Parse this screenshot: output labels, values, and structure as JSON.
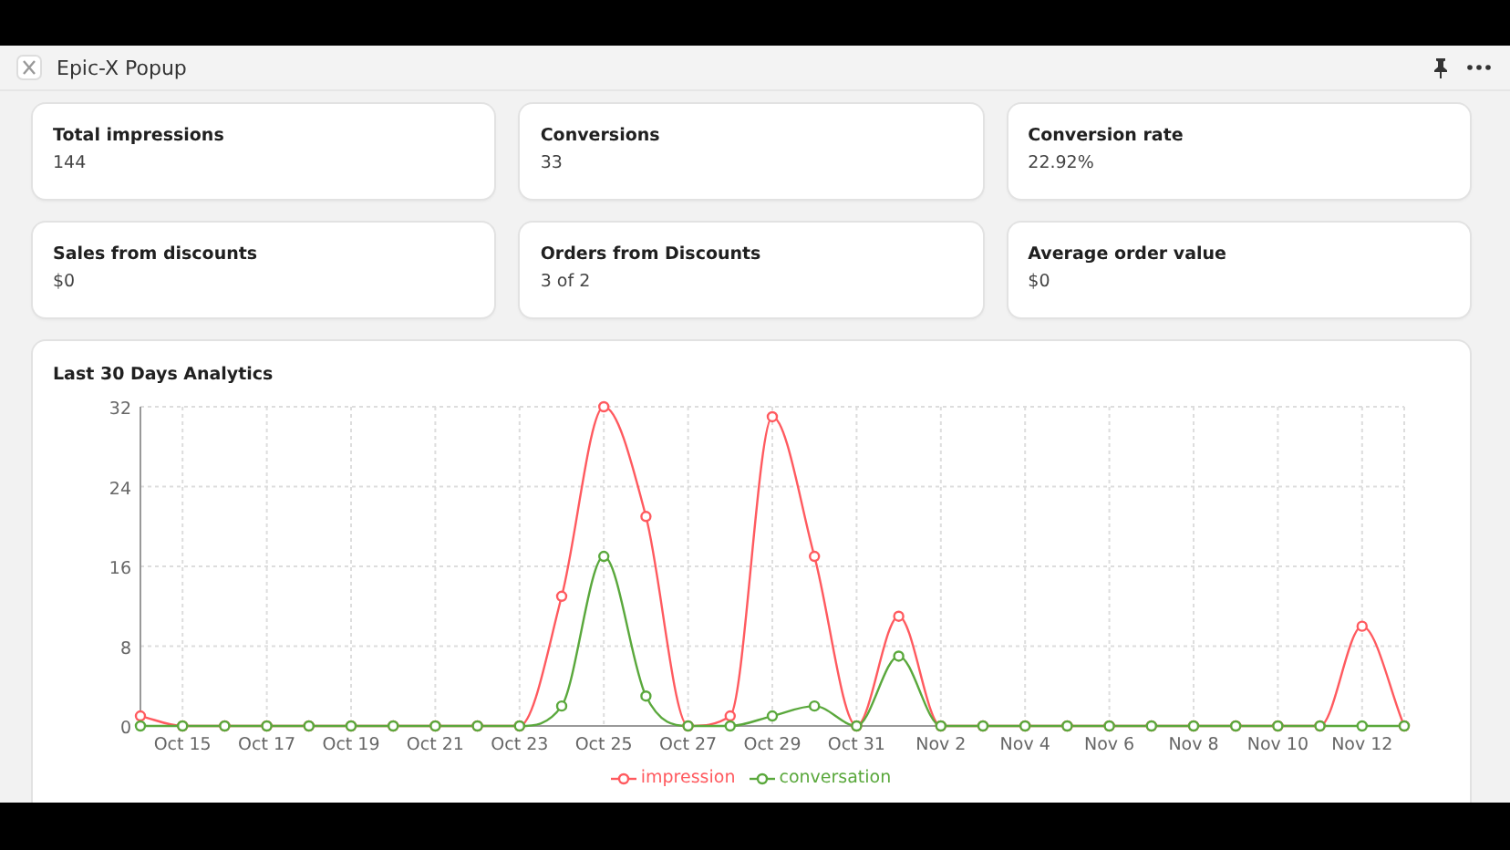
{
  "window": {
    "title": "Epic-X Popup"
  },
  "stats": [
    {
      "label": "Total impressions",
      "value": "144"
    },
    {
      "label": "Conversions",
      "value": "33"
    },
    {
      "label": "Conversion rate",
      "value": "22.92%"
    },
    {
      "label": "Sales from discounts",
      "value": "$0"
    },
    {
      "label": "Orders from Discounts",
      "value": "3 of 2"
    },
    {
      "label": "Average order value",
      "value": "$0"
    }
  ],
  "analytics": {
    "title": "Last 30 Days Analytics",
    "chart_data": {
      "type": "line",
      "categories": [
        null,
        "Oct 15",
        null,
        "Oct 17",
        null,
        "Oct 19",
        null,
        "Oct 21",
        null,
        "Oct 23",
        null,
        "Oct 25",
        null,
        "Oct 27",
        null,
        "Oct 29",
        null,
        "Oct 31",
        null,
        "Nov 2",
        null,
        "Nov 4",
        null,
        "Nov 6",
        null,
        "Nov 8",
        null,
        "Nov 10",
        null,
        "Nov 12",
        null
      ],
      "ylim": [
        0,
        32
      ],
      "yticks": [
        0,
        8,
        16,
        24,
        32
      ],
      "grid": true,
      "series": [
        {
          "name": "impression",
          "color": "#ff5a5f",
          "marker": true,
          "values": [
            1,
            0,
            0,
            0,
            0,
            0,
            0,
            0,
            0,
            0,
            13,
            32,
            21,
            0,
            1,
            31,
            17,
            0,
            11,
            0,
            0,
            0,
            0,
            0,
            0,
            0,
            0,
            0,
            0,
            10,
            0
          ]
        },
        {
          "name": "conversation",
          "color": "#5aa83c",
          "marker": true,
          "values": [
            0,
            0,
            0,
            0,
            0,
            0,
            0,
            0,
            0,
            0,
            2,
            17,
            3,
            0,
            0,
            1,
            2,
            0,
            7,
            0,
            0,
            0,
            0,
            0,
            0,
            0,
            0,
            0,
            0,
            0,
            0
          ]
        }
      ]
    }
  }
}
